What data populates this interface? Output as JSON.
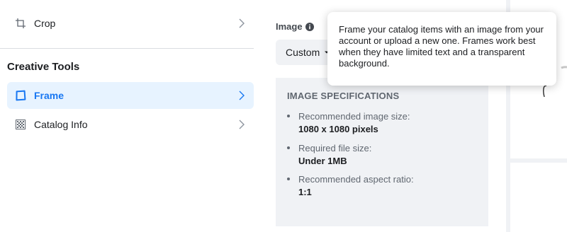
{
  "menu": {
    "crop_label": "Crop",
    "section_title": "Creative Tools",
    "frame_label": "Frame",
    "catalog_label": "Catalog Info"
  },
  "image_setting": {
    "label": "Image",
    "dropdown_value": "Custom"
  },
  "specifications": {
    "title": "IMAGE SPECIFICATIONS",
    "items": [
      {
        "name": "Recommended image size:",
        "value": "1080 x 1080 pixels"
      },
      {
        "name": "Required file size:",
        "value": "Under 1MB"
      },
      {
        "name": "Recommended aspect ratio:",
        "value": "1:1"
      }
    ]
  },
  "tooltip": {
    "text": "Frame your catalog items with an image from your account or upload a new one. Frames work best when they have limited text and a transparent background."
  },
  "colors": {
    "accent": "#1877f2",
    "selected_bg": "#e7f3ff",
    "panel_bg": "#f0f2f5"
  },
  "icons": {
    "crop": "crop-icon",
    "frame": "frame-icon",
    "catalog": "catalog-grid-icon",
    "chevron": "chevron-right-icon",
    "info": "info-icon",
    "caret": "caret-down-icon"
  }
}
